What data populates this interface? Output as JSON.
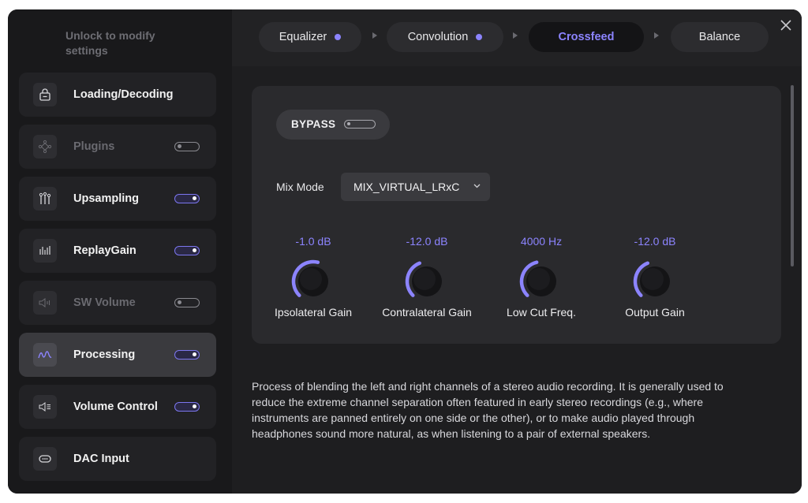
{
  "sidebar": {
    "unlock_text": "Unlock to modify settings",
    "items": [
      {
        "label": "Loading/Decoding",
        "icon": "lock-icon",
        "toggle": null,
        "disabled": false,
        "active": false
      },
      {
        "label": "Plugins",
        "icon": "plugin-icon",
        "toggle": "off",
        "disabled": true,
        "active": false
      },
      {
        "label": "Upsampling",
        "icon": "sliders-icon",
        "toggle": "on",
        "disabled": false,
        "active": false
      },
      {
        "label": "ReplayGain",
        "icon": "bars-icon",
        "toggle": "on",
        "disabled": false,
        "active": false
      },
      {
        "label": "SW Volume",
        "icon": "speaker-icon",
        "toggle": "off",
        "disabled": true,
        "active": false
      },
      {
        "label": "Processing",
        "icon": "waveform-icon",
        "toggle": "on",
        "disabled": false,
        "active": true
      },
      {
        "label": "Volume  Control",
        "icon": "volume-control-icon",
        "toggle": "on",
        "disabled": false,
        "active": false
      },
      {
        "label": "DAC Input",
        "icon": "dac-icon",
        "toggle": null,
        "disabled": false,
        "active": false
      }
    ]
  },
  "tabs": [
    {
      "label": "Equalizer",
      "has_dot": true,
      "active": false
    },
    {
      "label": "Convolution",
      "has_dot": true,
      "active": false
    },
    {
      "label": "Crossfeed",
      "has_dot": false,
      "active": true
    },
    {
      "label": "Balance",
      "has_dot": false,
      "active": false
    }
  ],
  "panel": {
    "bypass_label": "BYPASS",
    "bypass_state": "off",
    "mix_mode_label": "Mix Mode",
    "mix_mode_value": "MIX_VIRTUAL_LRxC",
    "knobs": [
      {
        "value": "-1.0 dB",
        "label": "Ipsolateral Gain",
        "level": 0.55
      },
      {
        "value": "-12.0 dB",
        "label": "Contralateral Gain",
        "level": 0.42
      },
      {
        "value": "4000 Hz",
        "label": "Low Cut Freq.",
        "level": 0.45
      },
      {
        "value": "-12.0 dB",
        "label": "Output Gain",
        "level": 0.42
      }
    ]
  },
  "description": "Process of blending the left and right channels of a stereo audio recording. It is generally used to reduce the extreme channel separation often featured in early stereo recordings (e.g., where instruments are panned entirely on one side or the other), or to make audio played through headphones sound more natural, as when listening to a pair of external speakers.",
  "colors": {
    "accent": "#8c84ff",
    "background": "#1b1b1d"
  }
}
